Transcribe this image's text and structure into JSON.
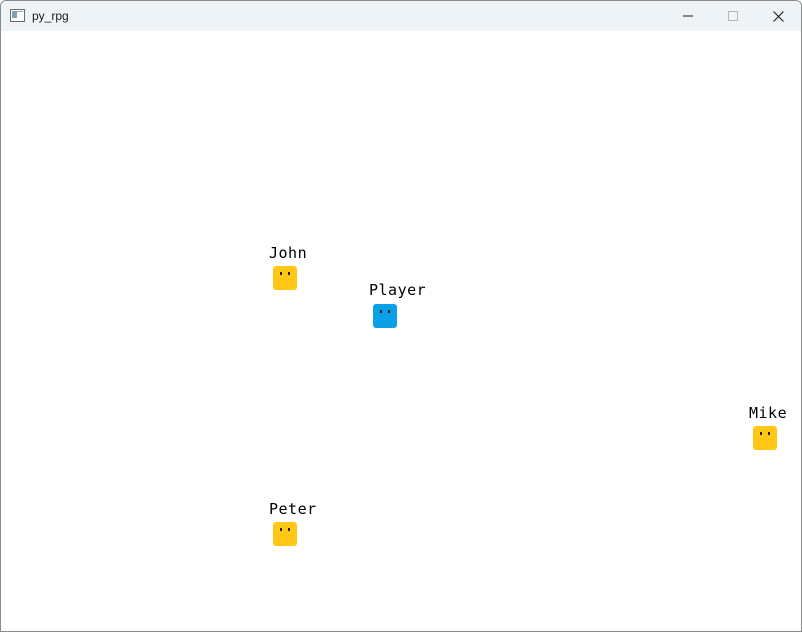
{
  "window": {
    "title": "py_rpg",
    "controls": [
      "minimize-icon",
      "maximize-icon",
      "close-icon"
    ]
  },
  "colors": {
    "npc": "#FFC814",
    "player": "#0AA0E6",
    "background": "#FFFFFF",
    "titlebar": "#EEF3F7"
  },
  "characters": [
    {
      "id": "john",
      "name": "John",
      "type": "npc"
    },
    {
      "id": "player",
      "name": "Player",
      "type": "player"
    },
    {
      "id": "mike",
      "name": "Mike",
      "type": "npc"
    },
    {
      "id": "peter",
      "name": "Peter",
      "type": "npc"
    }
  ]
}
